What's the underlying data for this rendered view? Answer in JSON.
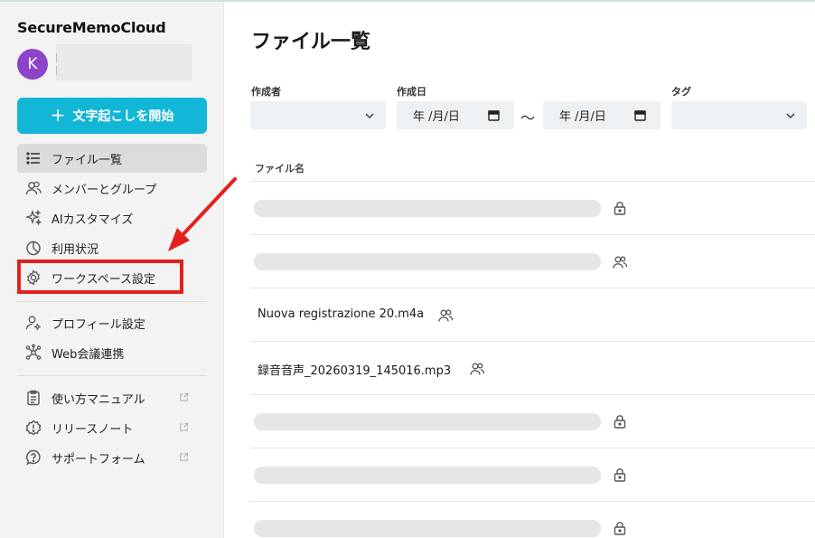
{
  "app": {
    "brand": "SecureMemoCloud",
    "avatar_initial": "K"
  },
  "sidebar": {
    "start_button_label": "文字起こしを開始",
    "start_button_icon": "plus-icon",
    "items": [
      {
        "label": "ファイル一覧",
        "icon": "list-icon",
        "active": true
      },
      {
        "label": "メンバーとグループ",
        "icon": "users-icon"
      },
      {
        "label": "AIカスタマイズ",
        "icon": "sparkle-icon"
      },
      {
        "label": "利用状況",
        "icon": "pie-chart-icon"
      },
      {
        "label": "ワークスペース設定",
        "icon": "gear-icon",
        "highlighted": true
      },
      {
        "label": "プロフィール設定",
        "icon": "user-gear-icon"
      },
      {
        "label": "Web会議連携",
        "icon": "network-icon"
      },
      {
        "label": "使い方マニュアル",
        "icon": "clipboard-icon",
        "external": true
      },
      {
        "label": "リリースノート",
        "icon": "alert-badge-icon",
        "external": true
      },
      {
        "label": "サポートフォーム",
        "icon": "question-bubble-icon",
        "external": true
      }
    ]
  },
  "main": {
    "title": "ファイル一覧",
    "filters": {
      "creator_label": "作成者",
      "created_date_label": "作成日",
      "date_from_placeholder": "年 /月/日",
      "date_to_placeholder": "年 /月/日",
      "range_separator": "〜",
      "tag_label": "タグ"
    },
    "table": {
      "column_file_name": "ファイル名",
      "rows": [
        {
          "name": "",
          "redacted": true,
          "access_icon": "lock-icon"
        },
        {
          "name": "",
          "redacted": true,
          "access_icon": "group-icon"
        },
        {
          "name": "Nuova registrazione 20.m4a",
          "redacted": false,
          "access_icon": "group-icon"
        },
        {
          "name": "録音音声_20260319_145016.mp3",
          "redacted": false,
          "access_icon": "group-icon"
        },
        {
          "name": "",
          "redacted": true,
          "access_icon": "lock-icon"
        },
        {
          "name": "",
          "redacted": true,
          "access_icon": "lock-icon"
        },
        {
          "name": "",
          "redacted": true,
          "access_icon": "lock-icon"
        }
      ]
    }
  },
  "colors": {
    "accent": "#12b6d6",
    "avatar": "#8e44c9",
    "annotation": "#e3211c"
  }
}
